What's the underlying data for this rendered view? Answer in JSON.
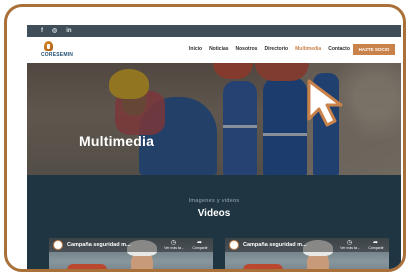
{
  "topbar": {
    "social": [
      {
        "icon": "facebook-icon",
        "glyph": "f"
      },
      {
        "icon": "instagram-icon",
        "glyph": "◎"
      },
      {
        "icon": "linkedin-icon",
        "glyph": "in"
      }
    ]
  },
  "navbar": {
    "logo_text": "CORESEMIN",
    "menu": [
      {
        "label": "Inicio",
        "active": false
      },
      {
        "label": "Noticias",
        "active": false
      },
      {
        "label": "Nosotros",
        "active": false
      },
      {
        "label": "Directorio",
        "active": false
      },
      {
        "label": "Multimedia",
        "active": true
      },
      {
        "label": "Contacto",
        "active": false
      }
    ],
    "cta_label": "HAZTE SOCIO"
  },
  "hero": {
    "title": "Multimedia"
  },
  "videos_section": {
    "kicker": "Imagenes y videos",
    "title": "Videos",
    "videos": [
      {
        "title": "Campaña seguridad m...",
        "watch_later": "Ver más ta...",
        "share": "Compartir"
      },
      {
        "title": "Campaña seguridad m...",
        "watch_later": "Ver más ta...",
        "share": "Compartir"
      }
    ]
  },
  "colors": {
    "accent": "#c9824a",
    "frame": "#a9703a",
    "section_bg": "#1f3642",
    "topbar_bg": "#3f4e58"
  }
}
